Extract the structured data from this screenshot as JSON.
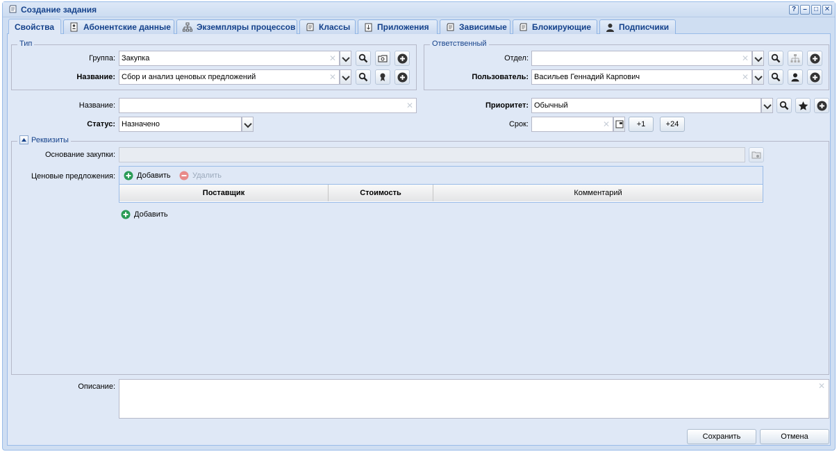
{
  "window": {
    "title": "Создание задания",
    "controls": [
      "?",
      "–",
      "□",
      "✕"
    ]
  },
  "tabs": [
    {
      "label": "Свойства",
      "icon": "none",
      "active": true
    },
    {
      "label": "Абонентские данные",
      "icon": "contact-card-icon"
    },
    {
      "label": "Экземпляры процессов",
      "icon": "process-tree-icon"
    },
    {
      "label": "Классы",
      "icon": "scroll-icon"
    },
    {
      "label": "Приложения",
      "icon": "attachment-icon"
    },
    {
      "label": "Зависимые",
      "icon": "scroll-icon"
    },
    {
      "label": "Блокирующие",
      "icon": "scroll-icon"
    },
    {
      "label": "Подписчики",
      "icon": "user-icon"
    }
  ],
  "type_group": {
    "legend": "Тип",
    "group_label": "Группа:",
    "group_value": "Закупка",
    "name_label": "Название:",
    "name_value": "Сбор и анализ ценовых предложений"
  },
  "responsible_group": {
    "legend": "Ответственный",
    "department_label": "Отдел:",
    "department_value": "",
    "user_label": "Пользователь:",
    "user_value": "Васильев Геннадий Карпович"
  },
  "form": {
    "title_label": "Название:",
    "title_value": "",
    "status_label": "Статус:",
    "status_value": "Назначено",
    "priority_label": "Приоритет:",
    "priority_value": "Обычный",
    "deadline_label": "Срок:",
    "deadline_value": "",
    "plus1_label": "+1",
    "plus24_label": "+24"
  },
  "details": {
    "legend": "Реквизиты",
    "basis_label": "Основание закупки:",
    "basis_value": "",
    "offers_label": "Ценовые предложения:",
    "add_label": "Добавить",
    "delete_label": "Удалить",
    "columns": [
      "Поставщик",
      "Стоимость",
      "Комментарий"
    ],
    "add_row_label": "Добавить"
  },
  "description": {
    "label": "Описание:",
    "value": ""
  },
  "footer": {
    "save_label": "Сохранить",
    "cancel_label": "Отмена"
  },
  "colors": {
    "window_bg": "#cfdef2",
    "panel_bg": "#dfe8f6",
    "title_text": "#15428b",
    "add_green": "#2a9b56",
    "delete_red": "#e88a8a"
  }
}
